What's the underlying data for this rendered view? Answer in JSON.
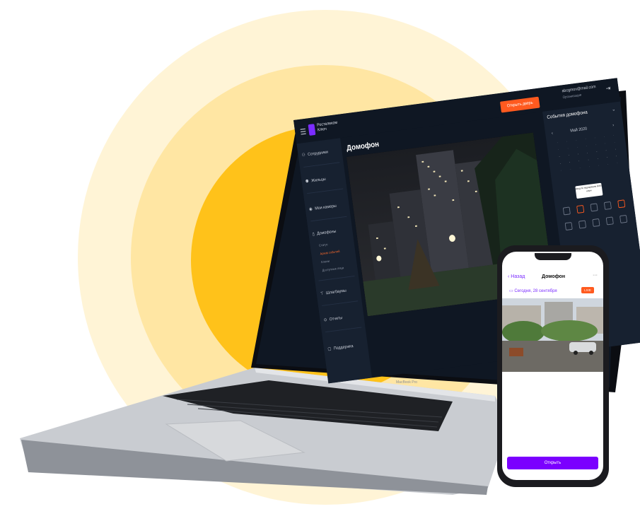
{
  "laptop": {
    "brand_line": "Ростелеком Ключ",
    "open_door_button": "Открыть дверь",
    "user_email": "abcgmox@mail.com",
    "user_org": "Организация",
    "page_title": "Домофон",
    "model_label": "MacBook Pro",
    "sidebar": {
      "items": [
        {
          "label": "Сотрудники",
          "icon": "person-icon"
        },
        {
          "label": "Жильцы",
          "icon": "people-icon"
        },
        {
          "label": "Мои камеры",
          "icon": "camera-icon"
        },
        {
          "label": "Домофоны",
          "icon": "intercom-icon"
        },
        {
          "label": "Шлагбаумы",
          "icon": "barrier-icon"
        },
        {
          "label": "Отчеты",
          "icon": "report-icon"
        },
        {
          "label": "Поддержка",
          "icon": "support-icon"
        }
      ],
      "subitems": [
        {
          "label": "Статус",
          "active": false
        },
        {
          "label": "Архив событий",
          "active": true
        },
        {
          "label": "Ключи",
          "active": false
        },
        {
          "label": "Доступные лица",
          "active": false
        }
      ]
    },
    "right_panel": {
      "title": "События домофона",
      "month": "Май 2020",
      "tooltip": "Вход по подозрению ЖКХ ключ"
    }
  },
  "phone": {
    "back_label": "Назад",
    "title": "Домофон",
    "more": "···",
    "date": "Сегодня, 28 сентября",
    "badge": "LIVE",
    "open_button": "Открыть"
  },
  "colors": {
    "accent_orange": "#ff5a1f",
    "accent_purple": "#7b00ff",
    "ring_yellow": "#ffc21a"
  }
}
